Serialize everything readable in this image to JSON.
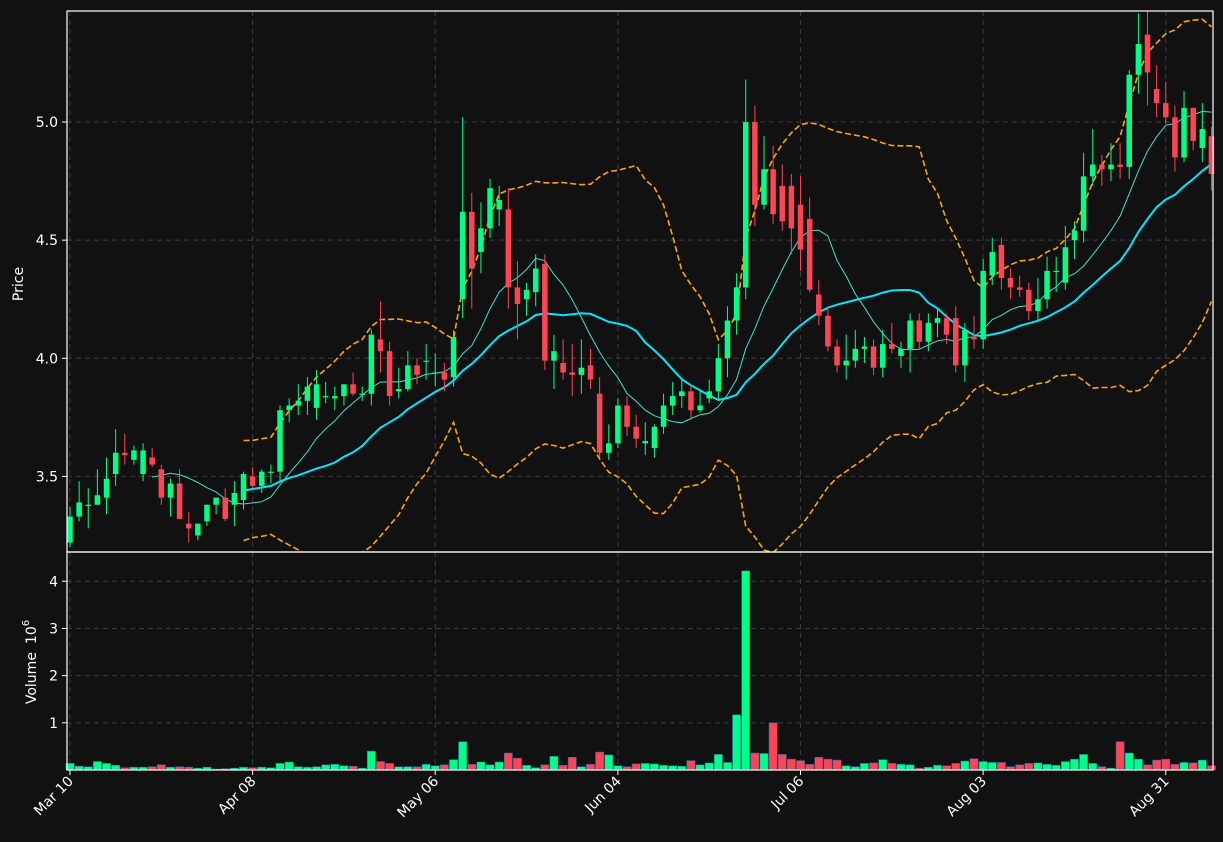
{
  "chart_data": {
    "type": "candlestick",
    "title": "",
    "price_axis": {
      "label": "Price",
      "ticks": [
        3.5,
        4.0,
        4.5,
        5.0
      ],
      "tick_labels": [
        "3.5",
        "4.0",
        "4.5",
        "5.0"
      ],
      "range": [
        3.18,
        5.47
      ]
    },
    "volume_axis": {
      "label": "Volume",
      "exponent_label": "10",
      "exponent_power": "6",
      "ticks": [
        1,
        2,
        3,
        4
      ],
      "tick_labels": [
        "1",
        "2",
        "3",
        "4"
      ],
      "range": [
        0,
        4.62
      ]
    },
    "x_axis": {
      "start_date": "Mar 10",
      "ticks": [
        {
          "index": 0,
          "label": "Mar 10"
        },
        {
          "index": 20,
          "label": "Apr 08"
        },
        {
          "index": 40,
          "label": "May 06"
        },
        {
          "index": 60,
          "label": "Jun 04"
        },
        {
          "index": 80,
          "label": "Jul 06"
        },
        {
          "index": 100,
          "label": "Aug 03"
        },
        {
          "index": 120,
          "label": "Aug 31"
        }
      ]
    },
    "grid": true,
    "colors": {
      "background": "#111111",
      "up": "#00ff88",
      "down": "#ff4455",
      "sma_slow": "#00e5ff",
      "sma_fast": "#40e0d0",
      "bollinger": "#ffa500",
      "frame": "#ffffff",
      "grid": "#3c3c3c"
    },
    "series_close": [
      3.33,
      3.39,
      3.38,
      3.42,
      3.49,
      3.6,
      3.59,
      3.61,
      3.61,
      3.55,
      3.41,
      3.47,
      3.32,
      3.28,
      3.3,
      3.38,
      3.41,
      3.32,
      3.43,
      3.51,
      3.46,
      3.52,
      3.52,
      3.78,
      3.8,
      3.82,
      3.88,
      3.89,
      3.84,
      3.84,
      3.89,
      3.85,
      3.85,
      4.1,
      4.03,
      3.84,
      3.87,
      3.97,
      3.93,
      3.99,
      3.94,
      3.91,
      4.09,
      4.62,
      4.38,
      4.55,
      4.72,
      4.67,
      4.3,
      4.23,
      4.29,
      4.38,
      3.99,
      4.03,
      3.94,
      3.93,
      3.96,
      3.91,
      3.6,
      3.64,
      3.8,
      3.71,
      3.66,
      3.65,
      3.71,
      3.8,
      3.84,
      3.86,
      3.78,
      3.8,
      3.86,
      4.0,
      4.16,
      4.3,
      5.0,
      4.65,
      4.8,
      4.61,
      4.58,
      4.55,
      4.46,
      4.29,
      4.18,
      4.05,
      3.97,
      3.99,
      4.04,
      4.05,
      3.96,
      4.06,
      4.04,
      4.04,
      4.16,
      4.07,
      4.15,
      4.17,
      4.1,
      3.97,
      4.12,
      4.08,
      4.37,
      4.45,
      4.34,
      4.3,
      4.29,
      4.2,
      4.25,
      4.37,
      4.37,
      4.47,
      4.54,
      4.77,
      4.82,
      4.8,
      4.82,
      4.81,
      5.2,
      5.33,
      5.21,
      5.08,
      5.02,
      4.85,
      5.06,
      4.92,
      4.97,
      4.78
    ],
    "series_open": [
      3.22,
      3.33,
      3.38,
      3.38,
      3.41,
      3.51,
      3.6,
      3.57,
      3.51,
      3.58,
      3.53,
      3.41,
      3.47,
      3.3,
      3.25,
      3.31,
      3.38,
      3.41,
      3.38,
      3.4,
      3.5,
      3.46,
      3.52,
      3.52,
      3.78,
      3.8,
      3.82,
      3.79,
      3.84,
      3.83,
      3.84,
      3.89,
      3.85,
      3.85,
      4.08,
      4.03,
      3.86,
      3.87,
      3.97,
      3.99,
      3.94,
      3.94,
      3.92,
      4.25,
      4.62,
      4.45,
      4.55,
      4.63,
      4.63,
      4.3,
      4.25,
      4.28,
      4.4,
      3.99,
      3.98,
      3.94,
      3.93,
      3.97,
      3.85,
      3.6,
      3.64,
      3.8,
      3.71,
      3.64,
      3.62,
      3.71,
      3.8,
      3.84,
      3.86,
      3.78,
      3.83,
      3.86,
      4.0,
      4.16,
      4.3,
      5.0,
      4.65,
      4.8,
      4.73,
      4.73,
      4.65,
      4.59,
      4.27,
      4.18,
      4.05,
      3.97,
      3.99,
      4.04,
      4.05,
      3.96,
      4.06,
      4.01,
      4.04,
      4.16,
      4.07,
      4.15,
      4.17,
      4.17,
      3.97,
      4.09,
      4.08,
      4.35,
      4.48,
      4.34,
      4.3,
      4.29,
      4.2,
      4.25,
      4.37,
      4.32,
      4.5,
      4.54,
      4.77,
      4.82,
      4.8,
      4.82,
      4.81,
      5.2,
      5.37,
      5.14,
      5.08,
      5.02,
      4.85,
      5.06,
      4.89,
      4.94
    ],
    "series_high": [
      3.37,
      3.48,
      3.45,
      3.53,
      3.58,
      3.7,
      3.68,
      3.63,
      3.64,
      3.62,
      3.55,
      3.49,
      3.53,
      3.35,
      3.3,
      3.38,
      3.41,
      3.45,
      3.48,
      3.52,
      3.54,
      3.53,
      3.55,
      3.8,
      3.83,
      3.89,
      3.92,
      3.95,
      3.9,
      3.88,
      3.89,
      3.94,
      3.88,
      4.12,
      4.24,
      4.07,
      3.96,
      4.03,
      4.0,
      4.06,
      4.02,
      3.98,
      4.12,
      5.02,
      4.7,
      4.66,
      4.76,
      4.73,
      4.72,
      4.41,
      4.32,
      4.44,
      4.44,
      4.1,
      4.08,
      4.06,
      4.08,
      4.04,
      3.92,
      3.72,
      3.83,
      3.84,
      3.76,
      3.73,
      3.72,
      3.85,
      3.9,
      3.91,
      3.89,
      3.86,
      3.91,
      4.06,
      4.22,
      4.36,
      5.18,
      5.07,
      4.94,
      4.9,
      4.82,
      4.78,
      4.77,
      4.68,
      4.33,
      4.22,
      4.08,
      4.1,
      4.12,
      4.09,
      4.08,
      4.12,
      4.15,
      4.07,
      4.19,
      4.19,
      4.19,
      4.21,
      4.19,
      4.22,
      4.15,
      4.18,
      4.42,
      4.51,
      4.51,
      4.38,
      4.35,
      4.32,
      4.34,
      4.43,
      4.43,
      4.56,
      4.58,
      4.87,
      4.97,
      4.86,
      4.91,
      4.91,
      5.22,
      5.46,
      5.47,
      5.24,
      5.17,
      5.07,
      5.13,
      5.06,
      5.08,
      4.98
    ],
    "series_low": [
      3.2,
      3.31,
      3.28,
      3.38,
      3.34,
      3.46,
      3.55,
      3.55,
      3.48,
      3.54,
      3.38,
      3.33,
      3.33,
      3.22,
      3.23,
      3.29,
      3.34,
      3.31,
      3.29,
      3.36,
      3.45,
      3.43,
      3.47,
      3.48,
      3.73,
      3.76,
      3.76,
      3.74,
      3.81,
      3.78,
      3.8,
      3.84,
      3.82,
      3.8,
      3.94,
      3.8,
      3.83,
      3.86,
      3.89,
      3.91,
      3.88,
      3.86,
      3.88,
      4.17,
      4.21,
      4.36,
      4.51,
      4.56,
      4.21,
      4.08,
      4.18,
      4.22,
      3.95,
      3.87,
      3.91,
      3.84,
      3.85,
      3.87,
      3.58,
      3.57,
      3.62,
      3.67,
      3.62,
      3.59,
      3.58,
      3.68,
      3.76,
      3.79,
      3.74,
      3.77,
      3.81,
      3.82,
      3.92,
      4.1,
      4.25,
      4.56,
      4.63,
      4.57,
      4.54,
      4.44,
      4.37,
      4.28,
      4.14,
      4.03,
      3.94,
      3.91,
      3.96,
      3.98,
      3.93,
      3.92,
      4.02,
      3.96,
      3.94,
      4.04,
      4.03,
      4.09,
      4.06,
      3.94,
      3.9,
      4.04,
      4.04,
      4.31,
      4.29,
      4.25,
      4.26,
      4.16,
      4.16,
      4.21,
      4.28,
      4.29,
      4.42,
      4.49,
      4.73,
      4.73,
      4.75,
      4.76,
      4.76,
      5.12,
      5.07,
      5.02,
      4.99,
      4.79,
      4.83,
      4.88,
      4.83,
      4.71
    ],
    "series_volume": [
      0.14,
      0.08,
      0.07,
      0.18,
      0.14,
      0.1,
      0.05,
      0.06,
      0.06,
      0.07,
      0.11,
      0.06,
      0.07,
      0.06,
      0.04,
      0.06,
      0.02,
      0.03,
      0.04,
      0.06,
      0.05,
      0.06,
      0.05,
      0.14,
      0.17,
      0.07,
      0.06,
      0.07,
      0.11,
      0.12,
      0.09,
      0.08,
      0.04,
      0.4,
      0.18,
      0.14,
      0.07,
      0.07,
      0.07,
      0.12,
      0.09,
      0.11,
      0.22,
      0.6,
      0.12,
      0.17,
      0.11,
      0.17,
      0.36,
      0.25,
      0.1,
      0.05,
      0.11,
      0.29,
      0.1,
      0.27,
      0.07,
      0.12,
      0.38,
      0.32,
      0.09,
      0.07,
      0.13,
      0.14,
      0.13,
      0.1,
      0.09,
      0.08,
      0.2,
      0.11,
      0.15,
      0.33,
      0.16,
      1.17,
      4.22,
      0.36,
      0.35,
      1.0,
      0.33,
      0.23,
      0.2,
      0.12,
      0.27,
      0.23,
      0.21,
      0.09,
      0.07,
      0.14,
      0.15,
      0.22,
      0.14,
      0.12,
      0.11,
      0.04,
      0.06,
      0.1,
      0.09,
      0.14,
      0.19,
      0.24,
      0.18,
      0.16,
      0.16,
      0.07,
      0.11,
      0.14,
      0.15,
      0.12,
      0.1,
      0.18,
      0.23,
      0.33,
      0.14,
      0.07,
      0.04,
      0.6,
      0.36,
      0.23,
      0.11,
      0.21,
      0.23,
      0.12,
      0.16,
      0.15,
      0.21,
      0.09,
      0.22
    ]
  }
}
